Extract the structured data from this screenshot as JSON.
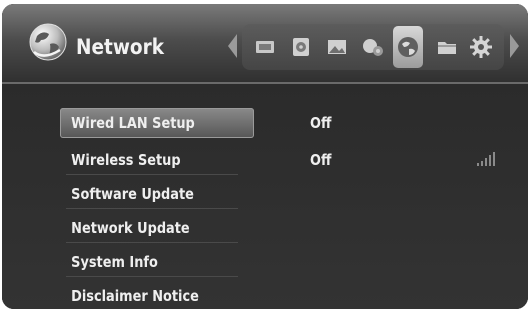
{
  "header": {
    "title": "Network",
    "section_icon": "globe-icon"
  },
  "top_icons": [
    {
      "name": "movie-icon",
      "selected": false
    },
    {
      "name": "disc-icon",
      "selected": false
    },
    {
      "name": "photo-icon",
      "selected": false
    },
    {
      "name": "music-settings-icon",
      "selected": false
    },
    {
      "name": "network-globe-icon",
      "selected": true
    },
    {
      "name": "folder-icon",
      "selected": false
    },
    {
      "name": "gear-icon",
      "selected": false
    }
  ],
  "menu": {
    "items": [
      {
        "label": "Wired LAN Setup",
        "value": "Off",
        "selected": true
      },
      {
        "label": "Wireless Setup",
        "value": "Off",
        "selected": false
      },
      {
        "label": "Software Update",
        "value": "",
        "selected": false
      },
      {
        "label": "Network Update",
        "value": "",
        "selected": false
      },
      {
        "label": "System Info",
        "value": "",
        "selected": false
      },
      {
        "label": "Disclaimer Notice",
        "value": "",
        "selected": false
      }
    ]
  },
  "wireless_signal_icon": "signal-strength-icon"
}
